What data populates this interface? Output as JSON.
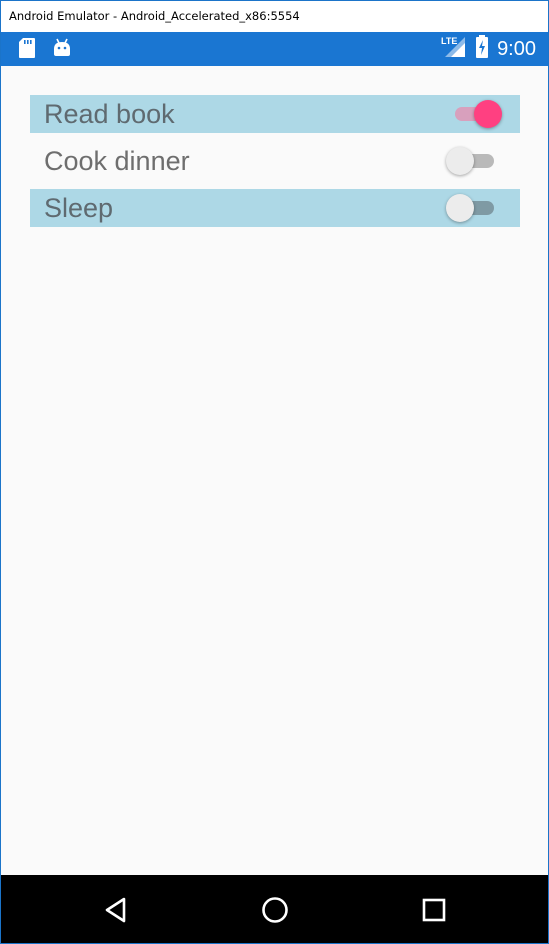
{
  "window": {
    "title": "Android Emulator - Android_Accelerated_x86:5554"
  },
  "status_bar": {
    "time": "9:00",
    "network_label": "LTE",
    "left_icons": [
      "sd-card-icon",
      "android-debug-icon"
    ],
    "right_icons": [
      "lte-signal-icon",
      "battery-charging-icon"
    ]
  },
  "list": {
    "items": [
      {
        "label": "Read book",
        "toggled": true,
        "highlighted": true
      },
      {
        "label": "Cook dinner",
        "toggled": false,
        "highlighted": false
      },
      {
        "label": "Sleep",
        "toggled": false,
        "highlighted": true
      }
    ]
  },
  "nav_bar": {
    "buttons": [
      "back-icon",
      "home-icon",
      "recents-icon"
    ]
  },
  "colors": {
    "status_bar": "#1a76d2",
    "row_highlight": "#add8e6",
    "switch_accent": "#ff4081",
    "background": "#fafafa",
    "nav_bar": "#000000"
  }
}
